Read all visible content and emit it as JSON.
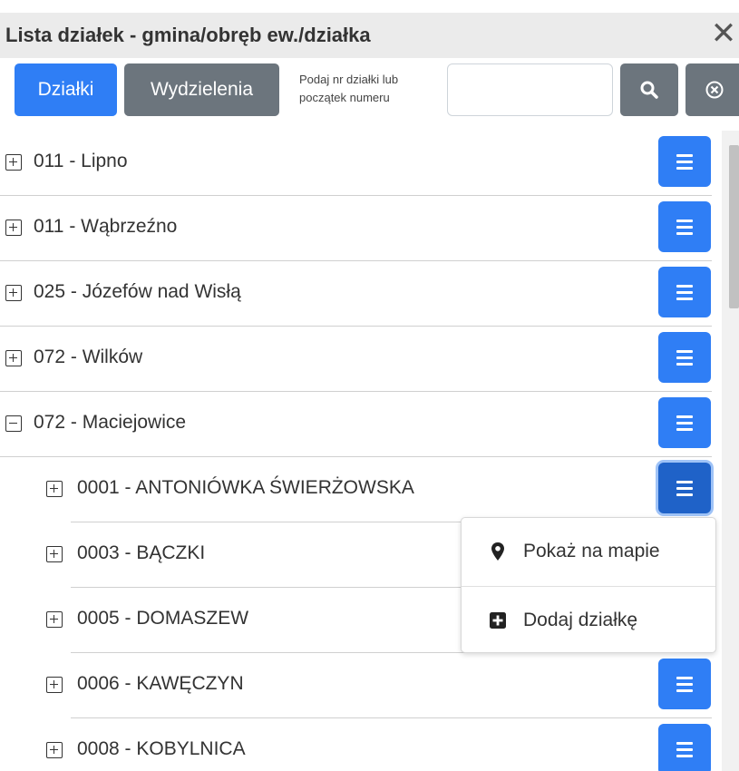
{
  "header": {
    "title": "Lista działek - gmina/obręb ew./działka",
    "close_label": "✕"
  },
  "toolbar": {
    "tab_dzialki": "Działki",
    "tab_wydzielenia": "Wydzielenia",
    "hint_line1": "Podaj nr działki lub",
    "hint_line2": "początek numeru",
    "search_value": "",
    "search_icon": "search-icon",
    "clear_icon": "clear-circle-icon"
  },
  "list": {
    "items": [
      {
        "label": "011 - Lipno",
        "expanded": false,
        "level": 0
      },
      {
        "label": "011 - Wąbrzeźno",
        "expanded": false,
        "level": 0
      },
      {
        "label": "025 - Józefów nad Wisłą",
        "expanded": false,
        "level": 0
      },
      {
        "label": "072 - Wilków",
        "expanded": false,
        "level": 0
      },
      {
        "label": "072 - Maciejowice",
        "expanded": true,
        "level": 0
      },
      {
        "label": "0001 - ANTONIÓWKA ŚWIERŻOWSKA",
        "expanded": false,
        "level": 1
      },
      {
        "label": "0003 - BĄCZKI",
        "expanded": false,
        "level": 1
      },
      {
        "label": "0005 - DOMASZEW",
        "expanded": false,
        "level": 1
      },
      {
        "label": "0006 - KAWĘCZYN",
        "expanded": false,
        "level": 1
      },
      {
        "label": "0008 - KOBYLNICA",
        "expanded": false,
        "level": 1
      }
    ]
  },
  "dropdown": {
    "show_on_map": "Pokaż na mapie",
    "add_parcel": "Dodaj działkę",
    "show_on_map_icon": "map-marker-icon",
    "add_parcel_icon": "plus-square-icon"
  },
  "colors": {
    "primary": "#2f7ef5",
    "secondary": "#6c757d",
    "titlebar": "#ebebeb"
  }
}
